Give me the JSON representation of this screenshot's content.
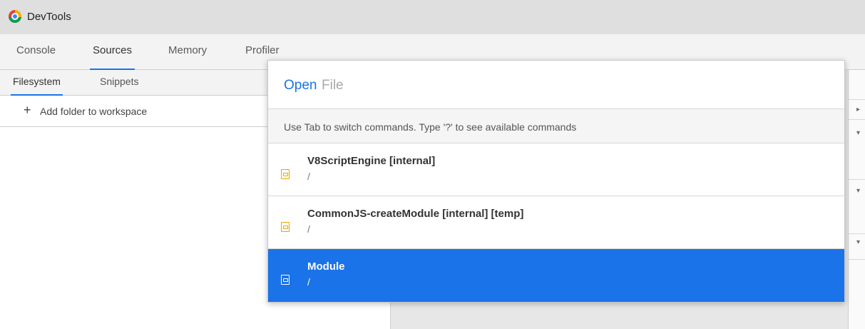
{
  "window": {
    "title": "DevTools"
  },
  "main_tabs": [
    {
      "label": "Console"
    },
    {
      "label": "Sources"
    },
    {
      "label": "Memory"
    },
    {
      "label": "Profiler"
    }
  ],
  "sources": {
    "subtabs": [
      {
        "label": "Filesystem"
      },
      {
        "label": "Snippets"
      }
    ],
    "add_folder_label": "Add folder to workspace"
  },
  "open_file": {
    "command": "Open",
    "placeholder": "File",
    "help_text": "Use Tab to switch commands. Type '?' to see available commands",
    "results": [
      {
        "name": "V8ScriptEngine [internal]",
        "path": "/"
      },
      {
        "name": "CommonJS-createModule [internal] [temp]",
        "path": "/"
      },
      {
        "name": "Module",
        "path": "/",
        "selected": true
      }
    ]
  },
  "colors": {
    "accent": "#1a73e8",
    "file_icon": "#e8a700"
  }
}
